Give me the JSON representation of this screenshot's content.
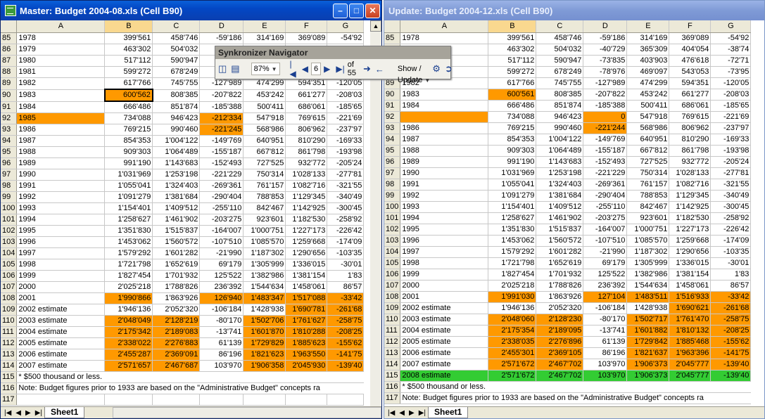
{
  "left_window": {
    "title": "Master: Budget 2004-08.xls (Cell B90)",
    "columns": [
      "A",
      "B",
      "C",
      "D",
      "E",
      "F",
      "G"
    ],
    "sheet_tab": "Sheet1",
    "rows": [
      {
        "n": "85",
        "a": "1978",
        "v": [
          "399'561",
          "458'746",
          "-59'186",
          "314'169",
          "369'089",
          "-54'92"
        ],
        "hl": []
      },
      {
        "n": "86",
        "a": "1979",
        "v": [
          "463'302",
          "504'032",
          "-40'729",
          "365'309",
          "404'054",
          "-38'74"
        ],
        "hl": []
      },
      {
        "n": "87",
        "a": "1980",
        "v": [
          "517'112",
          "590'947",
          "-73'835",
          "403'903",
          "476'618",
          "-72'71"
        ],
        "hl": []
      },
      {
        "n": "88",
        "a": "1981",
        "v": [
          "599'272",
          "678'249",
          "-78'976",
          "469'097",
          "543'053",
          "-73'95"
        ],
        "hl": []
      },
      {
        "n": "89",
        "a": "1982",
        "v": [
          "617'766",
          "745'755",
          "-127'989",
          "474'299",
          "594'351",
          "-120'05"
        ],
        "hl": []
      },
      {
        "n": "90",
        "a": "1983",
        "v": [
          "600'562",
          "808'385",
          "-207'822",
          "453'242",
          "661'277",
          "-208'03"
        ],
        "hl": [
          0
        ],
        "sel": true
      },
      {
        "n": "91",
        "a": "1984",
        "v": [
          "666'486",
          "851'874",
          "-185'388",
          "500'411",
          "686'061",
          "-185'65"
        ],
        "hl": []
      },
      {
        "n": "92",
        "a": "1985",
        "v": [
          "734'088",
          "946'423",
          "-212'334",
          "547'918",
          "769'615",
          "-221'69"
        ],
        "hl": [
          "a",
          2
        ]
      },
      {
        "n": "93",
        "a": "1986",
        "v": [
          "769'215",
          "990'460",
          "-221'245",
          "568'986",
          "806'962",
          "-237'97"
        ],
        "hl": [
          2
        ]
      },
      {
        "n": "94",
        "a": "1987",
        "v": [
          "854'353",
          "1'004'122",
          "-149'769",
          "640'951",
          "810'290",
          "-169'33"
        ],
        "hl": []
      },
      {
        "n": "95",
        "a": "1988",
        "v": [
          "909'303",
          "1'064'489",
          "-155'187",
          "667'812",
          "861'798",
          "-193'98"
        ],
        "hl": []
      },
      {
        "n": "96",
        "a": "1989",
        "v": [
          "991'190",
          "1'143'683",
          "-152'493",
          "727'525",
          "932'772",
          "-205'24"
        ],
        "hl": []
      },
      {
        "n": "97",
        "a": "1990",
        "v": [
          "1'031'969",
          "1'253'198",
          "-221'229",
          "750'314",
          "1'028'133",
          "-277'81"
        ],
        "hl": []
      },
      {
        "n": "98",
        "a": "1991",
        "v": [
          "1'055'041",
          "1'324'403",
          "-269'361",
          "761'157",
          "1'082'716",
          "-321'55"
        ],
        "hl": []
      },
      {
        "n": "99",
        "a": "1992",
        "v": [
          "1'091'279",
          "1'381'684",
          "-290'404",
          "788'853",
          "1'129'345",
          "-340'49"
        ],
        "hl": []
      },
      {
        "n": "100",
        "a": "1993",
        "v": [
          "1'154'401",
          "1'409'512",
          "-255'110",
          "842'467",
          "1'142'925",
          "-300'45"
        ],
        "hl": []
      },
      {
        "n": "101",
        "a": "1994",
        "v": [
          "1'258'627",
          "1'461'902",
          "-203'275",
          "923'601",
          "1'182'530",
          "-258'92"
        ],
        "hl": []
      },
      {
        "n": "102",
        "a": "1995",
        "v": [
          "1'351'830",
          "1'515'837",
          "-164'007",
          "1'000'751",
          "1'227'173",
          "-226'42"
        ],
        "hl": []
      },
      {
        "n": "103",
        "a": "1996",
        "v": [
          "1'453'062",
          "1'560'572",
          "-107'510",
          "1'085'570",
          "1'259'668",
          "-174'09"
        ],
        "hl": []
      },
      {
        "n": "104",
        "a": "1997",
        "v": [
          "1'579'292",
          "1'601'282",
          "-21'990",
          "1'187'302",
          "1'290'656",
          "-103'35"
        ],
        "hl": []
      },
      {
        "n": "105",
        "a": "1998",
        "v": [
          "1'721'798",
          "1'652'619",
          "69'179",
          "1'305'999",
          "1'336'015",
          "-30'01"
        ],
        "hl": []
      },
      {
        "n": "106",
        "a": "1999",
        "v": [
          "1'827'454",
          "1'701'932",
          "125'522",
          "1'382'986",
          "1'381'154",
          "1'83"
        ],
        "hl": []
      },
      {
        "n": "107",
        "a": "2000",
        "v": [
          "2'025'218",
          "1'788'826",
          "236'392",
          "1'544'634",
          "1'458'061",
          "86'57"
        ],
        "hl": []
      },
      {
        "n": "108",
        "a": "2001",
        "v": [
          "1'990'866",
          "1'863'926",
          "126'940",
          "1'483'347",
          "1'517'088",
          "-33'42"
        ],
        "hl": [
          0,
          2,
          3,
          4,
          5
        ]
      },
      {
        "n": "109",
        "a": "2002 estimate",
        "v": [
          "1'946'136",
          "2'052'320",
          "-106'184",
          "1'428'938",
          "1'690'781",
          "-261'68"
        ],
        "hl": [
          4,
          5
        ]
      },
      {
        "n": "110",
        "a": "2003 estimate",
        "v": [
          "2'048'049",
          "2'128'219",
          "-80'170",
          "1'502'706",
          "1'761'627",
          "-258'75"
        ],
        "hl": [
          0,
          1,
          3,
          4,
          5
        ]
      },
      {
        "n": "111",
        "a": "2004 estimate",
        "v": [
          "2'175'342",
          "2'189'083",
          "-13'741",
          "1'601'870",
          "1'810'288",
          "-208'25"
        ],
        "hl": [
          0,
          1,
          3,
          4,
          5
        ]
      },
      {
        "n": "112",
        "a": "2005 estimate",
        "v": [
          "2'338'022",
          "2'276'883",
          "61'139",
          "1'729'829",
          "1'885'623",
          "-155'62"
        ],
        "hl": [
          0,
          1,
          3,
          4,
          5
        ]
      },
      {
        "n": "113",
        "a": "2006 estimate",
        "v": [
          "2'455'287",
          "2'369'091",
          "86'196",
          "1'821'623",
          "1'963'550",
          "-141'75"
        ],
        "hl": [
          0,
          1,
          3,
          4,
          5
        ]
      },
      {
        "n": "114",
        "a": "2007 estimate",
        "v": [
          "2'571'657",
          "2'467'687",
          "103'970",
          "1'906'358",
          "2'045'930",
          "-139'40"
        ],
        "hl": [
          0,
          1,
          3,
          4,
          5
        ]
      },
      {
        "n": "115",
        "a": "* $500 thousand or less.",
        "v": [
          "",
          "",
          "",
          "",
          "",
          ""
        ],
        "hl": [],
        "span": true
      },
      {
        "n": "116",
        "a": "Note: Budget figures prior to 1933 are based on the \"Administrative Budget\" concepts ra",
        "v": [
          "",
          "",
          "",
          "",
          "",
          ""
        ],
        "hl": [],
        "span": true
      },
      {
        "n": "117",
        "a": "",
        "v": [
          "",
          "",
          "",
          "",
          "",
          ""
        ],
        "hl": []
      }
    ]
  },
  "right_window": {
    "title": "Update: Budget 2004-12.xls (Cell B90)",
    "columns": [
      "A",
      "B",
      "C",
      "D",
      "E",
      "F",
      "G"
    ],
    "sheet_tab": "Sheet1",
    "rows": [
      {
        "n": "85",
        "a": "1978",
        "v": [
          "399'561",
          "458'746",
          "-59'186",
          "314'169",
          "369'089",
          "-54'92"
        ],
        "hl": []
      },
      {
        "n": "86",
        "a": "1979",
        "v": [
          "463'302",
          "504'032",
          "-40'729",
          "365'309",
          "404'054",
          "-38'74"
        ],
        "hl": []
      },
      {
        "n": "87",
        "a": "1980",
        "v": [
          "517'112",
          "590'947",
          "-73'835",
          "403'903",
          "476'618",
          "-72'71"
        ],
        "hl": []
      },
      {
        "n": "88",
        "a": "1981",
        "v": [
          "599'272",
          "678'249",
          "-78'976",
          "469'097",
          "543'053",
          "-73'95"
        ],
        "hl": []
      },
      {
        "n": "89",
        "a": "1982",
        "v": [
          "617'766",
          "745'755",
          "-127'989",
          "474'299",
          "594'351",
          "-120'05"
        ],
        "hl": []
      },
      {
        "n": "90",
        "a": "1983",
        "v": [
          "600'561",
          "808'385",
          "-207'822",
          "453'242",
          "661'277",
          "-208'03"
        ],
        "hl": [
          0
        ]
      },
      {
        "n": "91",
        "a": "1984",
        "v": [
          "666'486",
          "851'874",
          "-185'388",
          "500'411",
          "686'061",
          "-185'65"
        ],
        "hl": []
      },
      {
        "n": "92",
        "a": "",
        "v": [
          "734'088",
          "946'423",
          "0",
          "547'918",
          "769'615",
          "-221'69"
        ],
        "hl": [
          "a",
          2
        ]
      },
      {
        "n": "93",
        "a": "1986",
        "v": [
          "769'215",
          "990'460",
          "-221'244",
          "568'986",
          "806'962",
          "-237'97"
        ],
        "hl": [
          2
        ]
      },
      {
        "n": "94",
        "a": "1987",
        "v": [
          "854'353",
          "1'004'122",
          "-149'769",
          "640'951",
          "810'290",
          "-169'33"
        ],
        "hl": []
      },
      {
        "n": "95",
        "a": "1988",
        "v": [
          "909'303",
          "1'064'489",
          "-155'187",
          "667'812",
          "861'798",
          "-193'98"
        ],
        "hl": []
      },
      {
        "n": "96",
        "a": "1989",
        "v": [
          "991'190",
          "1'143'683",
          "-152'493",
          "727'525",
          "932'772",
          "-205'24"
        ],
        "hl": []
      },
      {
        "n": "97",
        "a": "1990",
        "v": [
          "1'031'969",
          "1'253'198",
          "-221'229",
          "750'314",
          "1'028'133",
          "-277'81"
        ],
        "hl": []
      },
      {
        "n": "98",
        "a": "1991",
        "v": [
          "1'055'041",
          "1'324'403",
          "-269'361",
          "761'157",
          "1'082'716",
          "-321'55"
        ],
        "hl": []
      },
      {
        "n": "99",
        "a": "1992",
        "v": [
          "1'091'279",
          "1'381'684",
          "-290'404",
          "788'853",
          "1'129'345",
          "-340'49"
        ],
        "hl": []
      },
      {
        "n": "100",
        "a": "1993",
        "v": [
          "1'154'401",
          "1'409'512",
          "-255'110",
          "842'467",
          "1'142'925",
          "-300'45"
        ],
        "hl": []
      },
      {
        "n": "101",
        "a": "1994",
        "v": [
          "1'258'627",
          "1'461'902",
          "-203'275",
          "923'601",
          "1'182'530",
          "-258'92"
        ],
        "hl": []
      },
      {
        "n": "102",
        "a": "1995",
        "v": [
          "1'351'830",
          "1'515'837",
          "-164'007",
          "1'000'751",
          "1'227'173",
          "-226'42"
        ],
        "hl": []
      },
      {
        "n": "103",
        "a": "1996",
        "v": [
          "1'453'062",
          "1'560'572",
          "-107'510",
          "1'085'570",
          "1'259'668",
          "-174'09"
        ],
        "hl": []
      },
      {
        "n": "104",
        "a": "1997",
        "v": [
          "1'579'292",
          "1'601'282",
          "-21'990",
          "1'187'302",
          "1'290'656",
          "-103'35"
        ],
        "hl": []
      },
      {
        "n": "105",
        "a": "1998",
        "v": [
          "1'721'798",
          "1'652'619",
          "69'179",
          "1'305'999",
          "1'336'015",
          "-30'01"
        ],
        "hl": []
      },
      {
        "n": "106",
        "a": "1999",
        "v": [
          "1'827'454",
          "1'701'932",
          "125'522",
          "1'382'986",
          "1'381'154",
          "1'83"
        ],
        "hl": []
      },
      {
        "n": "107",
        "a": "2000",
        "v": [
          "2'025'218",
          "1'788'826",
          "236'392",
          "1'544'634",
          "1'458'061",
          "86'57"
        ],
        "hl": []
      },
      {
        "n": "108",
        "a": "2001",
        "v": [
          "1'991'030",
          "1'863'926",
          "127'104",
          "1'483'511",
          "1'516'933",
          "-33'42"
        ],
        "hl": [
          0,
          2,
          3,
          4,
          5
        ]
      },
      {
        "n": "109",
        "a": "2002 estimate",
        "v": [
          "1'946'136",
          "2'052'320",
          "-106'184",
          "1'428'938",
          "1'690'621",
          "-261'68"
        ],
        "hl": [
          4,
          5
        ]
      },
      {
        "n": "110",
        "a": "2003 estimate",
        "v": [
          "2'048'060",
          "2'128'230",
          "-80'170",
          "1'502'717",
          "1'761'470",
          "-258'75"
        ],
        "hl": [
          0,
          1,
          3,
          4,
          5
        ]
      },
      {
        "n": "111",
        "a": "2004 estimate",
        "v": [
          "2'175'354",
          "2'189'095",
          "-13'741",
          "1'601'882",
          "1'810'132",
          "-208'25"
        ],
        "hl": [
          0,
          1,
          3,
          4,
          5
        ]
      },
      {
        "n": "112",
        "a": "2005 estimate",
        "v": [
          "2'338'035",
          "2'276'896",
          "61'139",
          "1'729'842",
          "1'885'468",
          "-155'62"
        ],
        "hl": [
          0,
          1,
          3,
          4,
          5
        ]
      },
      {
        "n": "113",
        "a": "2006 estimate",
        "v": [
          "2'455'301",
          "2'369'105",
          "86'196",
          "1'821'637",
          "1'963'396",
          "-141'75"
        ],
        "hl": [
          0,
          1,
          3,
          4,
          5
        ]
      },
      {
        "n": "114",
        "a": "2007 estimate",
        "v": [
          "2'571'672",
          "2'467'702",
          "103'970",
          "1'906'373",
          "2'045'777",
          "-139'40"
        ],
        "hl": [
          0,
          1,
          3,
          4,
          5
        ]
      },
      {
        "n": "115",
        "a": "2008 estimate",
        "v": [
          "2'571'672",
          "2'467'702",
          "103'970",
          "1'906'373",
          "2'045'777",
          "-139'40"
        ],
        "hl": [],
        "green": true
      },
      {
        "n": "116",
        "a": "* $500 thousand or less.",
        "v": [
          "",
          "",
          "",
          "",
          "",
          ""
        ],
        "hl": [],
        "span": true
      },
      {
        "n": "117",
        "a": "Note: Budget figures prior to 1933 are based on the \"Administrative Budget\" concepts ra",
        "v": [
          "",
          "",
          "",
          "",
          "",
          ""
        ],
        "hl": [],
        "span": true
      }
    ]
  },
  "navigator": {
    "title": "Synkronizer Navigator",
    "zoom": "87%",
    "current": "6",
    "of_total": "of 55",
    "show_update": "Show / Update"
  },
  "colors": {
    "diff": "#ff9900",
    "added": "#33cc33",
    "active_title": "#0a4fc8"
  }
}
